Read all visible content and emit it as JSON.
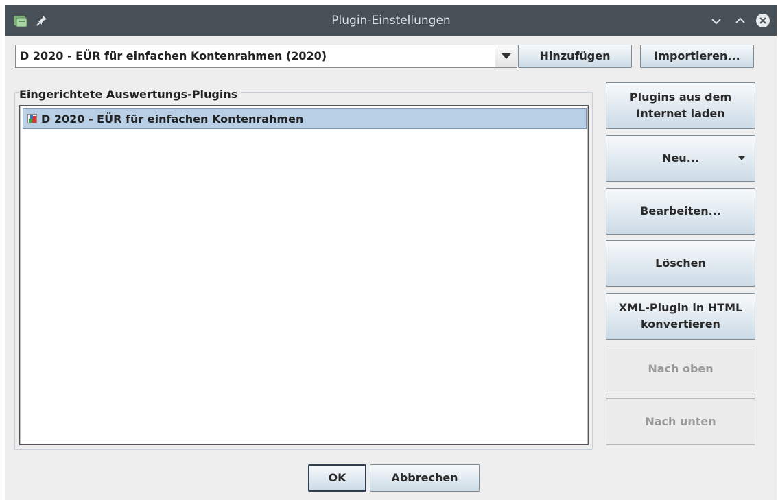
{
  "window": {
    "title": "Plugin-Einstellungen"
  },
  "combo": {
    "selected": "D 2020 - EÜR für einfachen Kontenrahmen (2020)"
  },
  "top_buttons": {
    "add": "Hinzufügen",
    "import": "Importieren..."
  },
  "group": {
    "label": "Eingerichtete Auswertungs-Plugins"
  },
  "list": {
    "items": [
      {
        "label": "D 2020 - EÜR für einfachen Kontenrahmen"
      }
    ]
  },
  "side_buttons": {
    "download_line1": "Plugins aus dem",
    "download_line2": "Internet laden",
    "new": "Neu...",
    "edit": "Bearbeiten...",
    "delete": "Löschen",
    "convert_line1": "XML-Plugin in HTML",
    "convert_line2": "konvertieren",
    "up": "Nach oben",
    "down": "Nach unten"
  },
  "footer": {
    "ok": "OK",
    "cancel": "Abbrechen"
  },
  "colors": {
    "titlebar": "#475057",
    "selection": "#b8cfe5",
    "button_top": "#f6f9fb",
    "button_bottom": "#ccdbe6"
  }
}
